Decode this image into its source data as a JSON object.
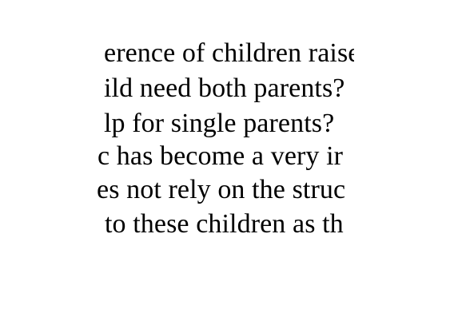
{
  "document": {
    "lines": [
      "erence of children raise",
      "ild need both parents?",
      "lp for single parents?",
      "c has become a very ir",
      "es not rely on the struc",
      "to these children as th"
    ]
  }
}
